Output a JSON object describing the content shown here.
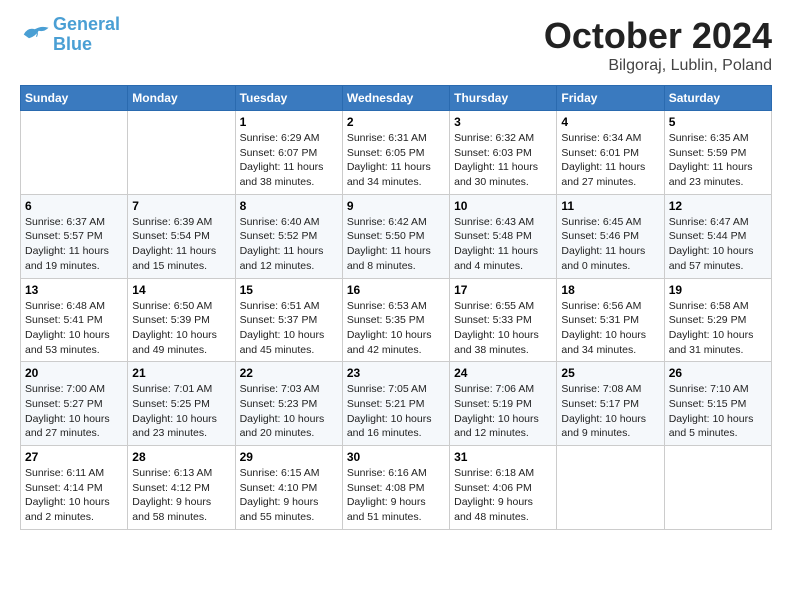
{
  "header": {
    "logo_line1": "General",
    "logo_line2": "Blue",
    "month": "October 2024",
    "location": "Bilgoraj, Lublin, Poland"
  },
  "weekdays": [
    "Sunday",
    "Monday",
    "Tuesday",
    "Wednesday",
    "Thursday",
    "Friday",
    "Saturday"
  ],
  "weeks": [
    [
      {
        "day": "",
        "content": ""
      },
      {
        "day": "",
        "content": ""
      },
      {
        "day": "1",
        "content": "Sunrise: 6:29 AM\nSunset: 6:07 PM\nDaylight: 11 hours\nand 38 minutes."
      },
      {
        "day": "2",
        "content": "Sunrise: 6:31 AM\nSunset: 6:05 PM\nDaylight: 11 hours\nand 34 minutes."
      },
      {
        "day": "3",
        "content": "Sunrise: 6:32 AM\nSunset: 6:03 PM\nDaylight: 11 hours\nand 30 minutes."
      },
      {
        "day": "4",
        "content": "Sunrise: 6:34 AM\nSunset: 6:01 PM\nDaylight: 11 hours\nand 27 minutes."
      },
      {
        "day": "5",
        "content": "Sunrise: 6:35 AM\nSunset: 5:59 PM\nDaylight: 11 hours\nand 23 minutes."
      }
    ],
    [
      {
        "day": "6",
        "content": "Sunrise: 6:37 AM\nSunset: 5:57 PM\nDaylight: 11 hours\nand 19 minutes."
      },
      {
        "day": "7",
        "content": "Sunrise: 6:39 AM\nSunset: 5:54 PM\nDaylight: 11 hours\nand 15 minutes."
      },
      {
        "day": "8",
        "content": "Sunrise: 6:40 AM\nSunset: 5:52 PM\nDaylight: 11 hours\nand 12 minutes."
      },
      {
        "day": "9",
        "content": "Sunrise: 6:42 AM\nSunset: 5:50 PM\nDaylight: 11 hours\nand 8 minutes."
      },
      {
        "day": "10",
        "content": "Sunrise: 6:43 AM\nSunset: 5:48 PM\nDaylight: 11 hours\nand 4 minutes."
      },
      {
        "day": "11",
        "content": "Sunrise: 6:45 AM\nSunset: 5:46 PM\nDaylight: 11 hours\nand 0 minutes."
      },
      {
        "day": "12",
        "content": "Sunrise: 6:47 AM\nSunset: 5:44 PM\nDaylight: 10 hours\nand 57 minutes."
      }
    ],
    [
      {
        "day": "13",
        "content": "Sunrise: 6:48 AM\nSunset: 5:41 PM\nDaylight: 10 hours\nand 53 minutes."
      },
      {
        "day": "14",
        "content": "Sunrise: 6:50 AM\nSunset: 5:39 PM\nDaylight: 10 hours\nand 49 minutes."
      },
      {
        "day": "15",
        "content": "Sunrise: 6:51 AM\nSunset: 5:37 PM\nDaylight: 10 hours\nand 45 minutes."
      },
      {
        "day": "16",
        "content": "Sunrise: 6:53 AM\nSunset: 5:35 PM\nDaylight: 10 hours\nand 42 minutes."
      },
      {
        "day": "17",
        "content": "Sunrise: 6:55 AM\nSunset: 5:33 PM\nDaylight: 10 hours\nand 38 minutes."
      },
      {
        "day": "18",
        "content": "Sunrise: 6:56 AM\nSunset: 5:31 PM\nDaylight: 10 hours\nand 34 minutes."
      },
      {
        "day": "19",
        "content": "Sunrise: 6:58 AM\nSunset: 5:29 PM\nDaylight: 10 hours\nand 31 minutes."
      }
    ],
    [
      {
        "day": "20",
        "content": "Sunrise: 7:00 AM\nSunset: 5:27 PM\nDaylight: 10 hours\nand 27 minutes."
      },
      {
        "day": "21",
        "content": "Sunrise: 7:01 AM\nSunset: 5:25 PM\nDaylight: 10 hours\nand 23 minutes."
      },
      {
        "day": "22",
        "content": "Sunrise: 7:03 AM\nSunset: 5:23 PM\nDaylight: 10 hours\nand 20 minutes."
      },
      {
        "day": "23",
        "content": "Sunrise: 7:05 AM\nSunset: 5:21 PM\nDaylight: 10 hours\nand 16 minutes."
      },
      {
        "day": "24",
        "content": "Sunrise: 7:06 AM\nSunset: 5:19 PM\nDaylight: 10 hours\nand 12 minutes."
      },
      {
        "day": "25",
        "content": "Sunrise: 7:08 AM\nSunset: 5:17 PM\nDaylight: 10 hours\nand 9 minutes."
      },
      {
        "day": "26",
        "content": "Sunrise: 7:10 AM\nSunset: 5:15 PM\nDaylight: 10 hours\nand 5 minutes."
      }
    ],
    [
      {
        "day": "27",
        "content": "Sunrise: 6:11 AM\nSunset: 4:14 PM\nDaylight: 10 hours\nand 2 minutes."
      },
      {
        "day": "28",
        "content": "Sunrise: 6:13 AM\nSunset: 4:12 PM\nDaylight: 9 hours\nand 58 minutes."
      },
      {
        "day": "29",
        "content": "Sunrise: 6:15 AM\nSunset: 4:10 PM\nDaylight: 9 hours\nand 55 minutes."
      },
      {
        "day": "30",
        "content": "Sunrise: 6:16 AM\nSunset: 4:08 PM\nDaylight: 9 hours\nand 51 minutes."
      },
      {
        "day": "31",
        "content": "Sunrise: 6:18 AM\nSunset: 4:06 PM\nDaylight: 9 hours\nand 48 minutes."
      },
      {
        "day": "",
        "content": ""
      },
      {
        "day": "",
        "content": ""
      }
    ]
  ]
}
